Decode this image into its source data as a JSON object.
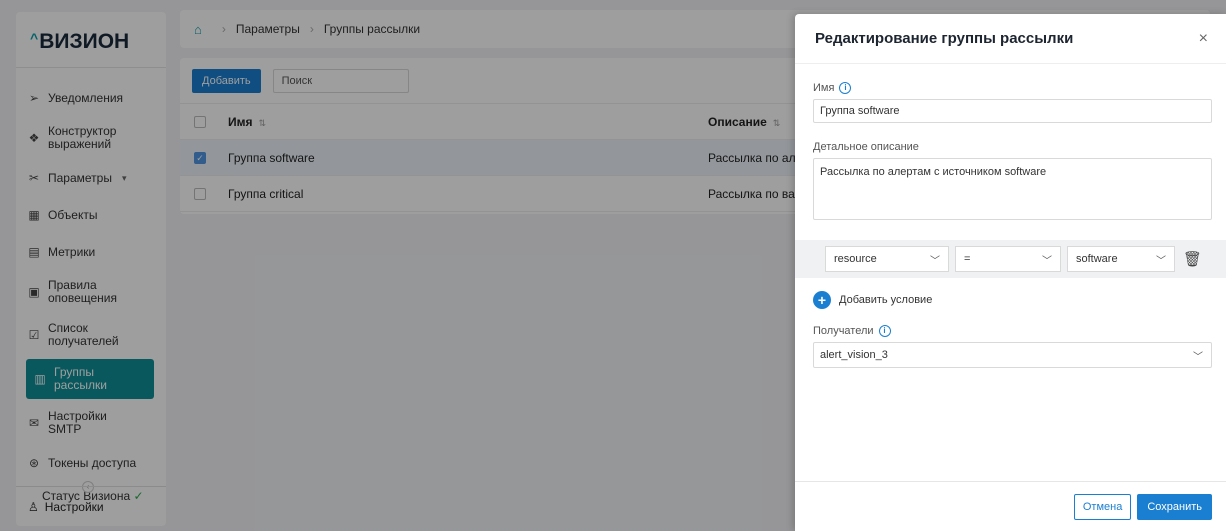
{
  "app": {
    "logo_caret": "^",
    "logo_text": "ВИЗИОН"
  },
  "sidebar": {
    "items": [
      {
        "icon": "send-icon",
        "glyph": "➢",
        "label": "Уведомления"
      },
      {
        "icon": "expression-icon",
        "glyph": "❖",
        "label": "Конструктор выражений"
      },
      {
        "icon": "tools-icon",
        "glyph": "✂",
        "label": "Параметры",
        "arrow": "▾"
      },
      {
        "icon": "objects-icon",
        "glyph": "▦",
        "label": "Объекты"
      },
      {
        "icon": "metrics-icon",
        "glyph": "▤",
        "label": "Метрики"
      },
      {
        "icon": "rules-icon",
        "glyph": "▣",
        "label": "Правила оповещения"
      },
      {
        "icon": "recipients-icon",
        "glyph": "☑",
        "label": "Список получателей"
      },
      {
        "icon": "groups-icon",
        "glyph": "▥",
        "label": "Группы рассылки"
      },
      {
        "icon": "smtp-icon",
        "glyph": "✉",
        "label": "Настройки SMTP"
      },
      {
        "icon": "token-icon",
        "glyph": "⊛",
        "label": "Токены доступа"
      }
    ],
    "status_label": "Статус Визиона",
    "status_check": "✓",
    "collapse_glyph": "‹",
    "bottom": {
      "icon": "user-icon",
      "glyph": "♙",
      "label": "Настройки"
    }
  },
  "breadcrumb": {
    "home_glyph": "⌂",
    "sep": "›",
    "items": [
      "Параметры",
      "Группы рассылки"
    ]
  },
  "toolbar": {
    "add_label": "Добавить",
    "search_placeholder": "Поиск"
  },
  "table": {
    "columns": [
      "Имя",
      "Описание"
    ],
    "sort_glyph": "⇅",
    "rows": [
      {
        "name": "Группа software",
        "description": "Рассылка по але",
        "checked": true
      },
      {
        "name": "Группа critical",
        "description": "Рассылка по важ",
        "checked": false
      }
    ]
  },
  "drawer": {
    "title": "Редактирование группы рассылки",
    "close_glyph": "×",
    "name_label": "Имя",
    "name_value": "Группа software",
    "description_label": "Детальное описание",
    "description_value": "Рассылка по алертам с источником software",
    "condition": {
      "field": "resource",
      "operator": "=",
      "value": "software",
      "chevron": "﹀",
      "trash_glyph": "🗑"
    },
    "add_condition_label": "Добавить условие",
    "recipients_label": "Получатели",
    "recipients_value": "alert_vision_3",
    "info_glyph": "i",
    "cancel_label": "Отмена",
    "save_label": "Сохранить"
  },
  "colors": {
    "accent": "#1a7fd1",
    "active_nav": "#0f8f97",
    "ok": "#2ba84a"
  }
}
